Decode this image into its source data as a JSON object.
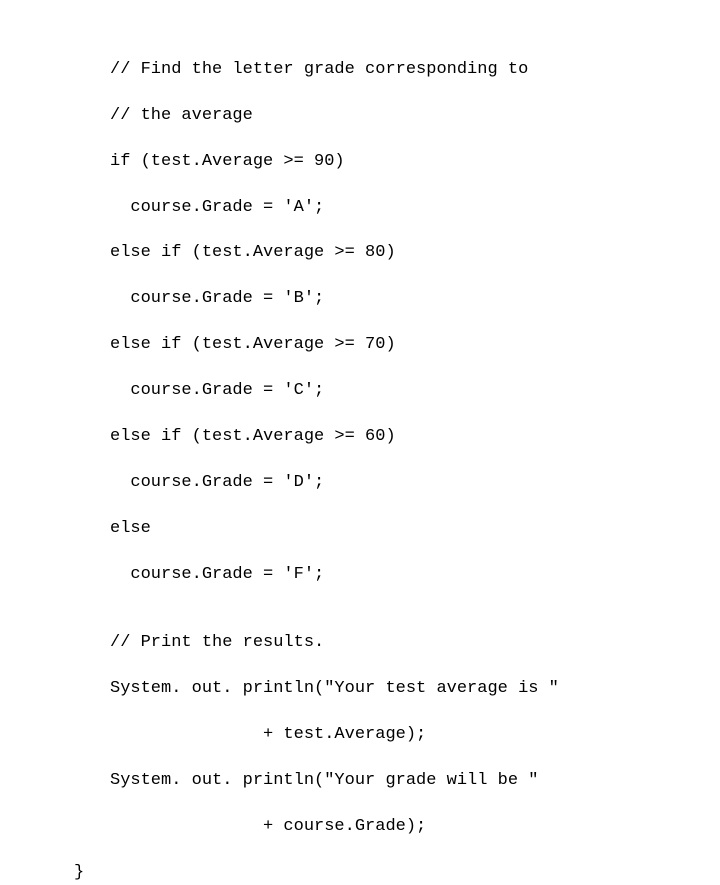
{
  "code": {
    "lines": [
      "// Find the letter grade corresponding to",
      "// the average",
      "if (test.Average >= 90)",
      "  course.Grade = 'A';",
      "else if (test.Average >= 80)",
      "  course.Grade = 'B';",
      "else if (test.Average >= 70)",
      "  course.Grade = 'C';",
      "else if (test.Average >= 60)",
      "  course.Grade = 'D';",
      "else",
      "  course.Grade = 'F';",
      "",
      "// Print the results.",
      "System. out. println(\"Your test average is \"",
      "               + test.Average);",
      "System. out. println(\"Your grade will be \"",
      "               + course.Grade);"
    ],
    "closing_brace": "}"
  }
}
